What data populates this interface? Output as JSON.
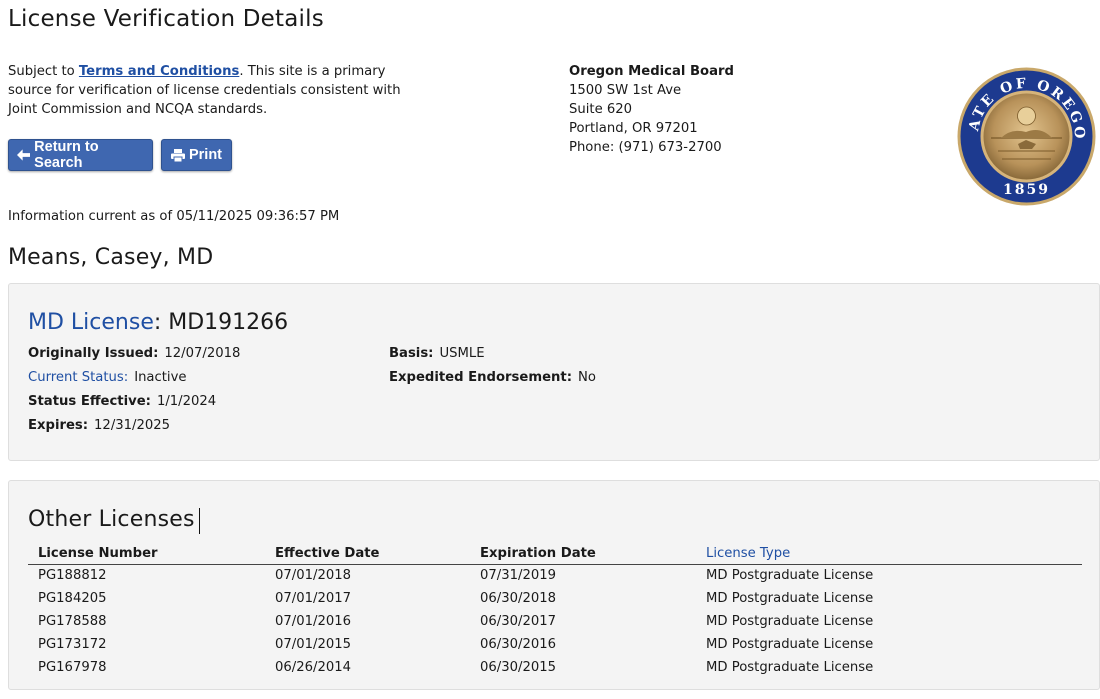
{
  "page_title": "License Verification Details",
  "intro": {
    "prefix": "Subject to ",
    "link_text": "Terms and Conditions",
    "suffix": ". This site is a primary source for verification of license credentials consistent with Joint Commission and NCQA standards."
  },
  "buttons": {
    "return_label": "Return to Search",
    "print_label": "Print"
  },
  "board": {
    "name": "Oregon Medical Board",
    "address1": "1500 SW 1st Ave",
    "address2": "Suite 620",
    "city": "Portland, OR 97201",
    "phone": "Phone: (971) 673-2700"
  },
  "seal": {
    "top_text": "STATE OF OREGON",
    "year": "1859"
  },
  "info_current": "Information current as of 05/11/2025 09:36:57 PM",
  "person_name": "Means, Casey, MD",
  "license": {
    "type_label": "MD License",
    "number": ": MD191266",
    "fields": {
      "originally_issued": {
        "label": "Originally Issued:",
        "value": "12/07/2018"
      },
      "current_status": {
        "label": "Current Status:",
        "value": "Inactive"
      },
      "status_effective": {
        "label": "Status Effective:",
        "value": "1/1/2024"
      },
      "expires": {
        "label": "Expires:",
        "value": "12/31/2025"
      },
      "basis": {
        "label": "Basis:",
        "value": "USMLE"
      },
      "expedited": {
        "label": "Expedited Endorsement:",
        "value": "No"
      }
    }
  },
  "other_licenses": {
    "title": "Other Licenses",
    "columns": [
      "License Number",
      "Effective Date",
      "Expiration Date",
      "License Type"
    ],
    "rows": [
      [
        "PG188812",
        "07/01/2018",
        "07/31/2019",
        "MD Postgraduate License"
      ],
      [
        "PG184205",
        "07/01/2017",
        "06/30/2018",
        "MD Postgraduate License"
      ],
      [
        "PG178588",
        "07/01/2016",
        "06/30/2017",
        "MD Postgraduate License"
      ],
      [
        "PG173172",
        "07/01/2015",
        "06/30/2016",
        "MD Postgraduate License"
      ],
      [
        "PG167978",
        "06/26/2014",
        "06/30/2015",
        "MD Postgraduate License"
      ]
    ]
  },
  "colors": {
    "link": "#1f4fa3",
    "button": "#3f67b0",
    "panel_bg": "#f4f4f4",
    "seal_ring": "#1d3a8f",
    "seal_gold": "#b8925a"
  },
  "icons": {
    "return": "arrow-left-icon",
    "print": "printer-icon"
  }
}
